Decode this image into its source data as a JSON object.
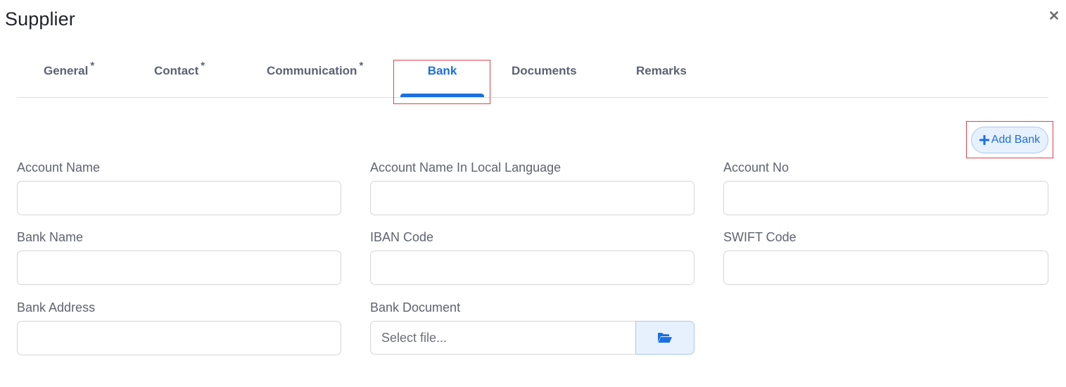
{
  "modal": {
    "title": "Supplier",
    "close_icon": "close-icon"
  },
  "tabs": [
    {
      "label": "General",
      "required": "*",
      "active": false
    },
    {
      "label": "Contact",
      "required": "*",
      "active": false
    },
    {
      "label": "Communication",
      "required": "*",
      "active": false
    },
    {
      "label": "Bank",
      "required": "",
      "active": true
    },
    {
      "label": "Documents",
      "required": "",
      "active": false
    },
    {
      "label": "Remarks",
      "required": "",
      "active": false
    }
  ],
  "colors": {
    "accent": "#1b6fe0",
    "tab_text": "#5a6275",
    "highlight": "#e0444c",
    "button_bg": "#e7f0fd"
  },
  "toolbar": {
    "add_bank_label": "Add Bank",
    "add_bank_icon": "plus-icon"
  },
  "form": {
    "account_name": {
      "label": "Account Name",
      "value": ""
    },
    "account_name_local": {
      "label": "Account Name In Local Language",
      "value": ""
    },
    "account_no": {
      "label": "Account No",
      "value": ""
    },
    "bank_name": {
      "label": "Bank Name",
      "value": ""
    },
    "iban_code": {
      "label": "IBAN Code",
      "value": ""
    },
    "swift_code": {
      "label": "SWIFT Code",
      "value": ""
    },
    "bank_address": {
      "label": "Bank Address",
      "value": ""
    },
    "bank_document": {
      "label": "Bank Document",
      "placeholder": "Select file...",
      "browse_icon": "folder-open-icon"
    }
  }
}
